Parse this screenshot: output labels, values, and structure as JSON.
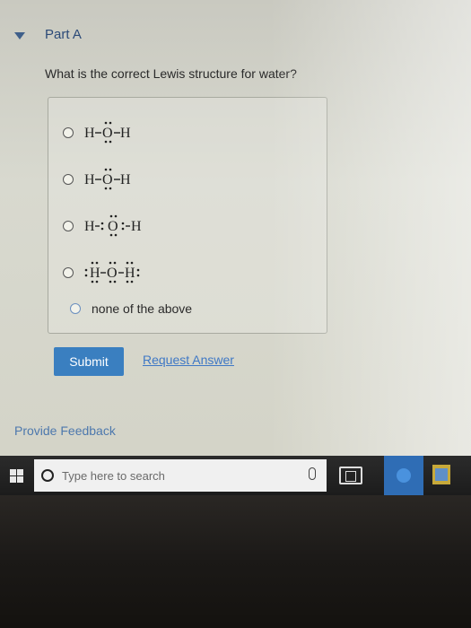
{
  "part": {
    "title": "Part A"
  },
  "question": {
    "text": "What is the correct Lewis structure for water?"
  },
  "options": [
    {
      "formula": "H–Ö–H"
    },
    {
      "formula": "H–Ö–H"
    },
    {
      "formula": "H–:Ö:–H"
    },
    {
      "formula": ":Ḧ–Ö–Ḧ:"
    },
    {
      "label": "none of the above"
    }
  ],
  "actions": {
    "submit_label": "Submit",
    "request_answer_label": "Request Answer",
    "feedback_label": "Provide Feedback"
  },
  "taskbar": {
    "search_placeholder": "Type here to search",
    "icons": [
      "windows-start-icon",
      "search-circle-icon",
      "microphone-icon",
      "task-view-icon",
      "app-icon",
      "file-explorer-icon"
    ]
  },
  "colors": {
    "accent_blue": "#3a7fc0",
    "link_blue": "#3f78c5",
    "header_blue": "#2c4a78"
  }
}
